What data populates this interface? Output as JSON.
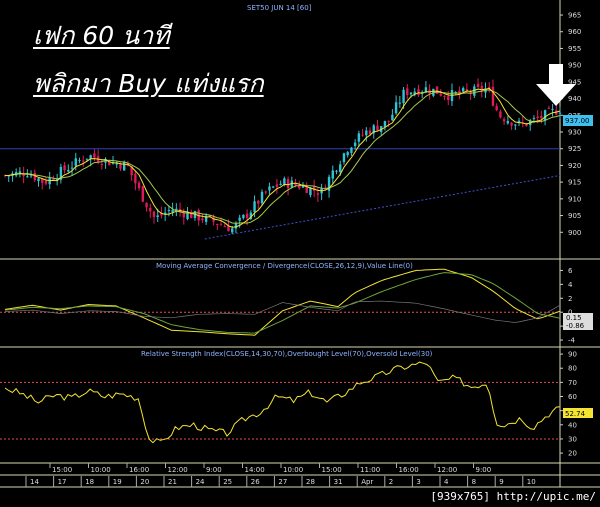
{
  "overlay": {
    "line1": "เฟก 60 นาที",
    "line2": "พลิกมา Buy แท่งแรก"
  },
  "caption": "[939x765] http://upic.me/",
  "colors": {
    "background": "#000000",
    "up_candle": "#2ec4d6",
    "down_candle": "#e0195a",
    "ma_fast": "#f2e431",
    "ma_slow": "#a7c94a",
    "macd_line": "#f2e431",
    "signal_line": "#6fa33a",
    "rsi_line": "#f2e431",
    "level_line": "#e05050",
    "hline": "#3040c0",
    "trend": "#4050d0",
    "panel_border": "#d8d8b0",
    "last_price_box": "#3fc0ee",
    "rsi_box": "#f2e431",
    "macd_box": "#dddddd"
  },
  "chart_data": [
    {
      "type": "candlestick",
      "title": "SET50 JUN 14  [60]",
      "ylim": [
        892,
        968
      ],
      "yticks": [
        900,
        905,
        910,
        915,
        920,
        925,
        930,
        935,
        940,
        945,
        950,
        955,
        960,
        965
      ],
      "last_value_label": "937.00",
      "horizontal_line": 925,
      "trendline": [
        [
          0.36,
          898
        ],
        [
          1.0,
          917
        ]
      ],
      "arrow": "down arrow pointing at last candle",
      "key_prices": [
        {
          "pos": 0.0,
          "price": 917
        },
        {
          "pos": 0.04,
          "price": 918
        },
        {
          "pos": 0.07,
          "price": 915
        },
        {
          "pos": 0.11,
          "price": 919
        },
        {
          "pos": 0.15,
          "price": 923
        },
        {
          "pos": 0.19,
          "price": 921
        },
        {
          "pos": 0.22,
          "price": 920
        },
        {
          "pos": 0.24,
          "price": 913
        },
        {
          "pos": 0.27,
          "price": 904
        },
        {
          "pos": 0.3,
          "price": 907
        },
        {
          "pos": 0.34,
          "price": 905
        },
        {
          "pos": 0.38,
          "price": 903
        },
        {
          "pos": 0.41,
          "price": 901
        },
        {
          "pos": 0.44,
          "price": 906
        },
        {
          "pos": 0.47,
          "price": 912
        },
        {
          "pos": 0.5,
          "price": 915
        },
        {
          "pos": 0.53,
          "price": 914
        },
        {
          "pos": 0.57,
          "price": 912
        },
        {
          "pos": 0.59,
          "price": 918
        },
        {
          "pos": 0.62,
          "price": 926
        },
        {
          "pos": 0.65,
          "price": 930
        },
        {
          "pos": 0.69,
          "price": 933
        },
        {
          "pos": 0.72,
          "price": 942
        },
        {
          "pos": 0.76,
          "price": 943
        },
        {
          "pos": 0.8,
          "price": 941
        },
        {
          "pos": 0.84,
          "price": 942
        },
        {
          "pos": 0.87,
          "price": 943
        },
        {
          "pos": 0.89,
          "price": 935
        },
        {
          "pos": 0.93,
          "price": 932
        },
        {
          "pos": 0.96,
          "price": 934
        },
        {
          "pos": 1.0,
          "price": 937
        }
      ]
    },
    {
      "type": "line",
      "title": "Moving Average Convergence / Divergence(CLOSE,26,12,9),Value Line(0)",
      "ylim": [
        -5,
        7.5
      ],
      "yticks": [
        -4,
        -2,
        0,
        2,
        4,
        6
      ],
      "value_labels": [
        "0.15",
        "-0.86"
      ],
      "series": [
        {
          "name": "MACD",
          "points": [
            [
              0.0,
              0.4
            ],
            [
              0.05,
              1.0
            ],
            [
              0.1,
              0.3
            ],
            [
              0.15,
              1.1
            ],
            [
              0.2,
              0.9
            ],
            [
              0.25,
              -0.8
            ],
            [
              0.3,
              -2.6
            ],
            [
              0.35,
              -2.8
            ],
            [
              0.4,
              -3.1
            ],
            [
              0.45,
              -3.3
            ],
            [
              0.5,
              0.2
            ],
            [
              0.55,
              1.6
            ],
            [
              0.6,
              0.8
            ],
            [
              0.63,
              2.8
            ],
            [
              0.68,
              4.6
            ],
            [
              0.74,
              6.0
            ],
            [
              0.79,
              6.2
            ],
            [
              0.84,
              5.0
            ],
            [
              0.88,
              3.0
            ],
            [
              0.92,
              0.5
            ],
            [
              0.96,
              -1.0
            ],
            [
              1.0,
              0.15
            ]
          ]
        },
        {
          "name": "Signal",
          "points": [
            [
              0.0,
              0.3
            ],
            [
              0.05,
              0.7
            ],
            [
              0.1,
              0.5
            ],
            [
              0.15,
              0.9
            ],
            [
              0.2,
              0.8
            ],
            [
              0.25,
              -0.2
            ],
            [
              0.3,
              -1.8
            ],
            [
              0.35,
              -2.5
            ],
            [
              0.4,
              -2.9
            ],
            [
              0.45,
              -3.0
            ],
            [
              0.5,
              -1.2
            ],
            [
              0.55,
              0.9
            ],
            [
              0.6,
              0.6
            ],
            [
              0.63,
              1.3
            ],
            [
              0.68,
              3.0
            ],
            [
              0.74,
              4.7
            ],
            [
              0.79,
              5.7
            ],
            [
              0.84,
              5.4
            ],
            [
              0.88,
              4.1
            ],
            [
              0.92,
              2.0
            ],
            [
              0.96,
              -0.2
            ],
            [
              1.0,
              -0.86
            ]
          ]
        }
      ]
    },
    {
      "type": "line",
      "title": "Relative Strength Index(CLOSE,14,30,70),Overbought Level(70),Oversold Level(30)",
      "ylim": [
        13,
        95
      ],
      "yticks": [
        20,
        30,
        40,
        50,
        60,
        70,
        80,
        90
      ],
      "overbought": 70,
      "oversold": 30,
      "value_label": "52.74",
      "series": [
        {
          "name": "RSI",
          "points": [
            [
              0.0,
              66
            ],
            [
              0.03,
              62
            ],
            [
              0.06,
              56
            ],
            [
              0.09,
              61
            ],
            [
              0.12,
              59
            ],
            [
              0.15,
              64
            ],
            [
              0.18,
              60
            ],
            [
              0.21,
              62
            ],
            [
              0.24,
              59
            ],
            [
              0.26,
              30
            ],
            [
              0.28,
              27
            ],
            [
              0.31,
              38
            ],
            [
              0.34,
              40
            ],
            [
              0.37,
              36
            ],
            [
              0.4,
              34
            ],
            [
              0.43,
              44
            ],
            [
              0.46,
              49
            ],
            [
              0.49,
              60
            ],
            [
              0.52,
              57
            ],
            [
              0.55,
              63
            ],
            [
              0.58,
              56
            ],
            [
              0.61,
              62
            ],
            [
              0.64,
              70
            ],
            [
              0.67,
              74
            ],
            [
              0.7,
              79
            ],
            [
              0.73,
              82
            ],
            [
              0.76,
              84
            ],
            [
              0.78,
              70
            ],
            [
              0.81,
              73
            ],
            [
              0.84,
              67
            ],
            [
              0.87,
              70
            ],
            [
              0.885,
              42
            ],
            [
              0.9,
              40
            ],
            [
              0.93,
              45
            ],
            [
              0.95,
              38
            ],
            [
              0.98,
              48
            ],
            [
              1.0,
              52.74
            ]
          ]
        }
      ]
    }
  ],
  "time_axis": {
    "top_labels": [
      "15:00",
      "10:00",
      "16:00",
      "12:00",
      "9:00",
      "14:00",
      "10:00",
      "15:00",
      "11:00",
      "16:00",
      "12:00",
      "9:00"
    ],
    "date_labels": [
      "14",
      "17",
      "18",
      "19",
      "20",
      "21",
      "24",
      "25",
      "26",
      "27",
      "28",
      "31",
      "Apr",
      "2",
      "3",
      "4",
      "8",
      "9",
      "10"
    ]
  }
}
